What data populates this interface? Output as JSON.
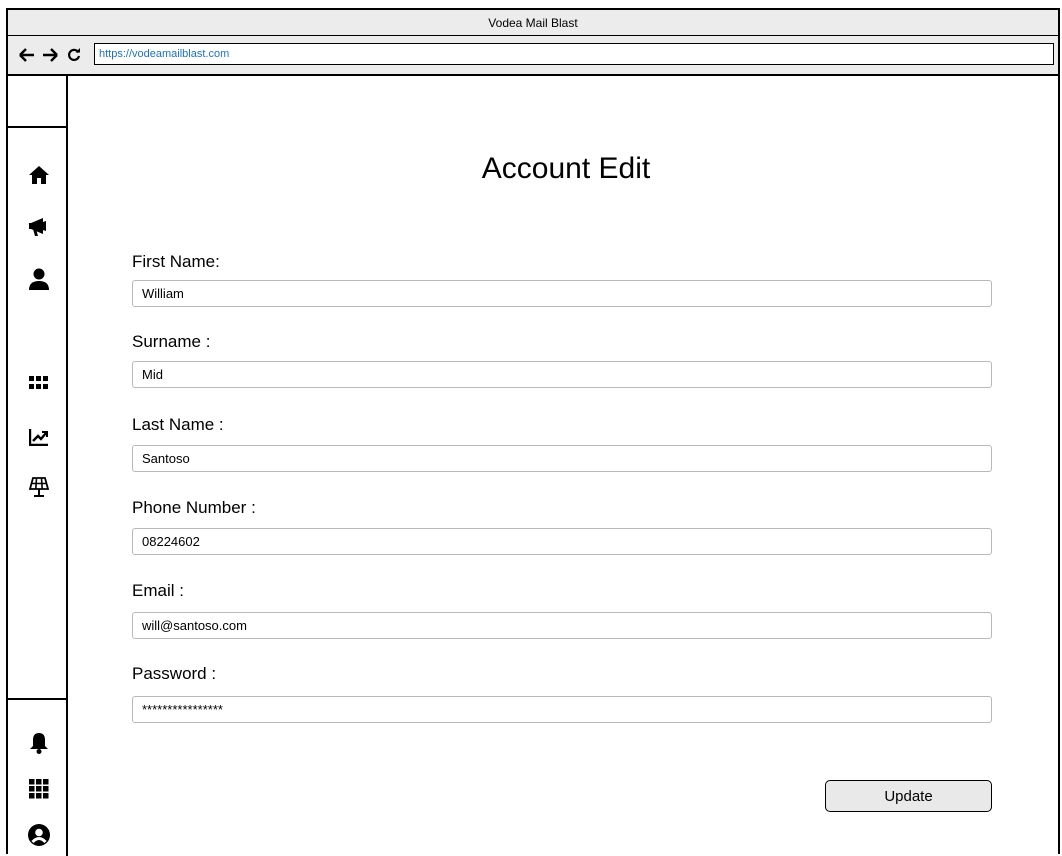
{
  "window": {
    "title": "Vodea Mail Blast"
  },
  "browser": {
    "url": "https://vodeamailblast.com",
    "back_icon": "arrow-left-icon",
    "forward_icon": "arrow-right-icon",
    "reload_icon": "reload-icon"
  },
  "sidebar": {
    "top_items": [
      {
        "icon": "home-icon"
      },
      {
        "icon": "megaphone-icon"
      },
      {
        "icon": "user-icon"
      }
    ],
    "middle_items": [
      {
        "icon": "grid-icon"
      },
      {
        "icon": "chart-line-icon"
      },
      {
        "icon": "solar-panel-icon"
      }
    ],
    "bottom_items": [
      {
        "icon": "bell-icon"
      },
      {
        "icon": "apps-grid-icon"
      },
      {
        "icon": "user-circle-icon"
      }
    ]
  },
  "page": {
    "title": "Account Edit"
  },
  "form": {
    "fields": [
      {
        "label": "First Name:",
        "value": "William"
      },
      {
        "label": "Surname :",
        "value": "Mid"
      },
      {
        "label": "Last Name :",
        "value": "Santoso"
      },
      {
        "label": "Phone Number :",
        "value": "08224602"
      },
      {
        "label": "Email :",
        "value": "will@santoso.com"
      },
      {
        "label": "Password :",
        "value": "****************"
      }
    ],
    "submit_label": "Update"
  }
}
